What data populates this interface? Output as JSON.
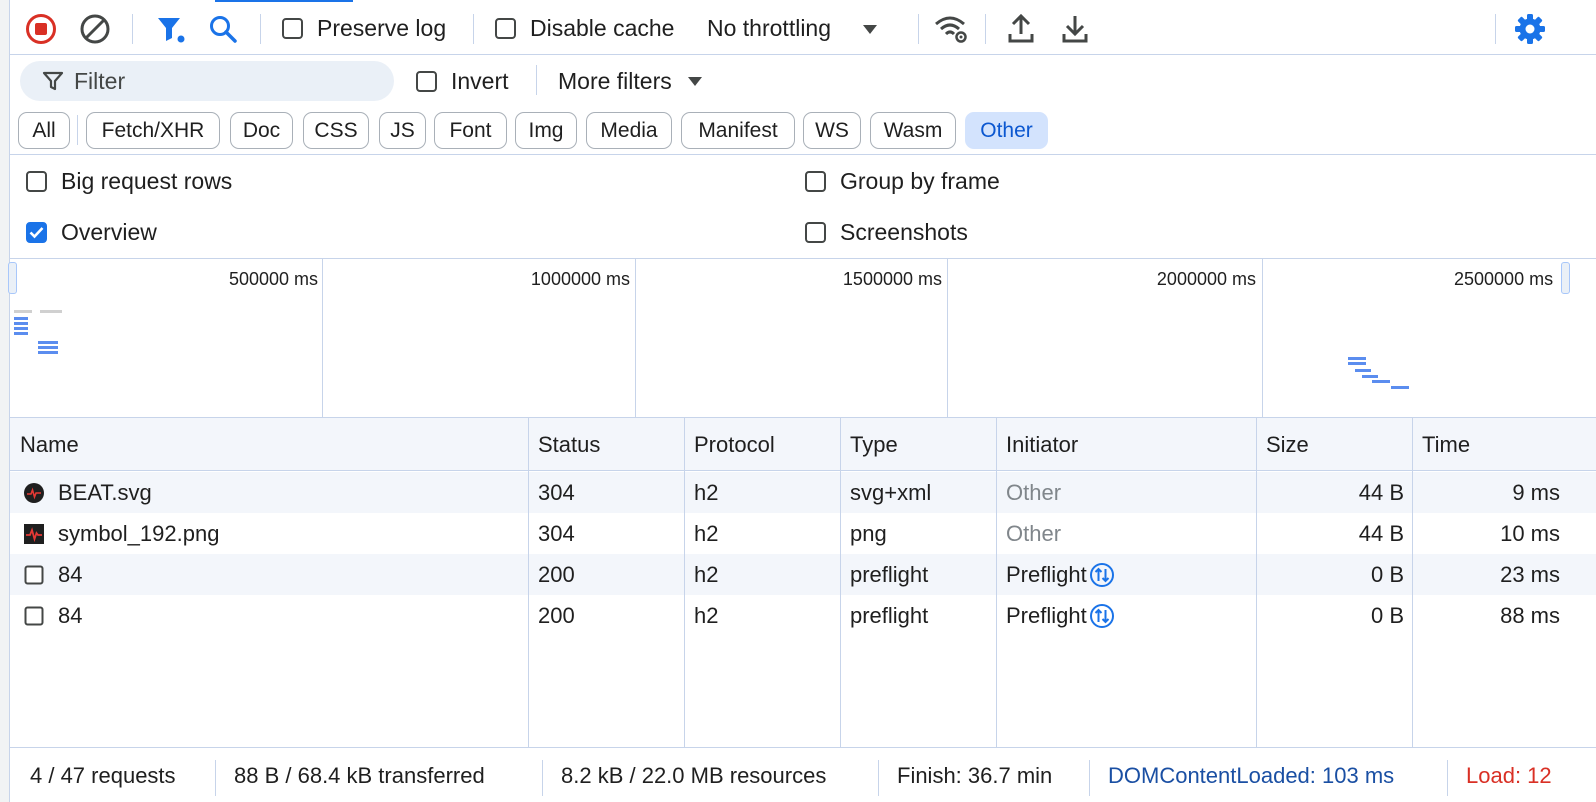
{
  "toolbar": {
    "preserve_log": {
      "label": "Preserve log",
      "checked": false
    },
    "disable_cache": {
      "label": "Disable cache",
      "checked": false
    },
    "throttling": {
      "value": "No throttling"
    },
    "icons": [
      "stop-recording-icon",
      "clear-icon",
      "filter-icon",
      "search-icon",
      "network-conditions-icon",
      "import-har-icon",
      "export-har-icon",
      "settings-gear-icon"
    ],
    "accent_color": "#1a73e8",
    "record_color": "#d93025"
  },
  "filter": {
    "placeholder": "Filter",
    "invert": {
      "label": "Invert",
      "checked": false
    },
    "more_filters": "More filters"
  },
  "type_filters": [
    {
      "label": "All",
      "active": false
    },
    {
      "label": "Fetch/XHR",
      "active": false
    },
    {
      "label": "Doc",
      "active": false
    },
    {
      "label": "CSS",
      "active": false
    },
    {
      "label": "JS",
      "active": false
    },
    {
      "label": "Font",
      "active": false
    },
    {
      "label": "Img",
      "active": false
    },
    {
      "label": "Media",
      "active": false
    },
    {
      "label": "Manifest",
      "active": false
    },
    {
      "label": "WS",
      "active": false
    },
    {
      "label": "Wasm",
      "active": false
    },
    {
      "label": "Other",
      "active": true
    }
  ],
  "settings": {
    "big_request_rows": {
      "label": "Big request rows",
      "checked": false
    },
    "group_by_frame": {
      "label": "Group by frame",
      "checked": false
    },
    "overview": {
      "label": "Overview",
      "checked": true
    },
    "screenshots": {
      "label": "Screenshots",
      "checked": false
    }
  },
  "overview": {
    "ticks": [
      "500000 ms",
      "1000000 ms",
      "1500000 ms",
      "2000000 ms",
      "2500000 ms"
    ]
  },
  "table": {
    "headers": {
      "name": "Name",
      "status": "Status",
      "protocol": "Protocol",
      "type": "Type",
      "initiator": "Initiator",
      "size": "Size",
      "time": "Time"
    },
    "rows": [
      {
        "name": "BEAT.svg",
        "icon": "beat-logo-icon",
        "status": "304",
        "protocol": "h2",
        "type": "svg+xml",
        "initiator": "Other",
        "size": "44 B",
        "time": "9 ms"
      },
      {
        "name": "symbol_192.png",
        "icon": "image-thumbnail-icon",
        "status": "304",
        "protocol": "h2",
        "type": "png",
        "initiator": "Other",
        "size": "44 B",
        "time": "10 ms"
      },
      {
        "name": "84",
        "icon": "document-icon",
        "status": "200",
        "protocol": "h2",
        "type": "preflight",
        "initiator": "Preflight",
        "size": "0 B",
        "time": "23 ms"
      },
      {
        "name": "84",
        "icon": "document-icon",
        "status": "200",
        "protocol": "h2",
        "type": "preflight",
        "initiator": "Preflight",
        "size": "0 B",
        "time": "88 ms"
      }
    ]
  },
  "status_bar": {
    "requests": "4 / 47 requests",
    "transferred": "88 B / 68.4 kB transferred",
    "resources": "8.2 kB / 22.0 MB resources",
    "finish": "Finish: 36.7 min",
    "dom_content_loaded": "DOMContentLoaded: 103 ms",
    "load": "Load: 12",
    "dom_color": "#1a4fa3",
    "load_color": "#d93025"
  }
}
